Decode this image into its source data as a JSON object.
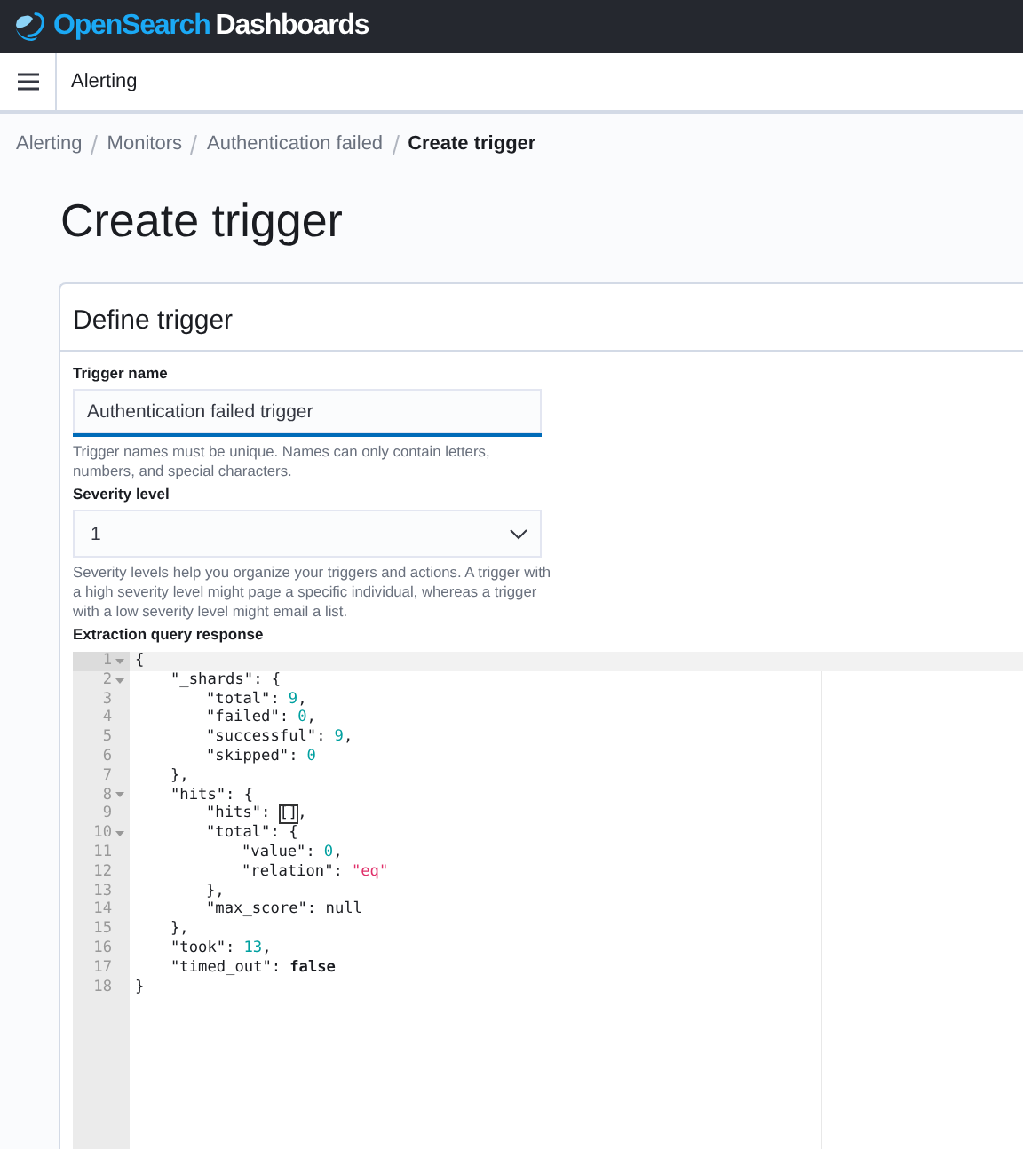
{
  "logo": {
    "brand": "OpenSearch",
    "product": "Dashboards"
  },
  "header": {
    "app_title": "Alerting"
  },
  "breadcrumbs": [
    {
      "label": "Alerting",
      "current": false
    },
    {
      "label": "Monitors",
      "current": false
    },
    {
      "label": "Authentication failed",
      "current": false
    },
    {
      "label": "Create trigger",
      "current": true
    }
  ],
  "page_title": "Create trigger",
  "panel": {
    "title": "Define trigger",
    "trigger_name": {
      "label": "Trigger name",
      "value": "Authentication failed trigger",
      "help": "Trigger names must be unique. Names can only contain letters, numbers, and special characters."
    },
    "severity": {
      "label": "Severity level",
      "value": "1",
      "help": "Severity levels help you organize your triggers and actions. A trigger with a high severity level might page a specific individual, whereas a trigger with a low severity level might email a list."
    },
    "response": {
      "label": "Extraction query response",
      "lines": [
        {
          "number": "1",
          "foldable": true,
          "active": true,
          "tokens": [
            {
              "kind": "punct",
              "text": "{"
            }
          ],
          "children": [
            {
              "number": "2",
              "foldable": true,
              "active": false,
              "tokens": [
                {
                  "kind": "key",
                  "text": "\"_shards\""
                },
                {
                  "kind": "punct",
                  "text": ": {"
                }
              ],
              "children": [
                {
                  "number": "3",
                  "foldable": false,
                  "active": false,
                  "tokens": [
                    {
                      "kind": "key",
                      "text": "\"total\""
                    },
                    {
                      "kind": "punct",
                      "text": ":"
                    },
                    {
                      "kind": "number",
                      "text": "9"
                    },
                    {
                      "kind": "punct",
                      "text": ","
                    }
                  ]
                },
                {
                  "number": "4",
                  "foldable": false,
                  "active": false,
                  "tokens": [
                    {
                      "kind": "key",
                      "text": "\"failed\""
                    },
                    {
                      "kind": "punct",
                      "text": ":"
                    },
                    {
                      "kind": "number",
                      "text": "0"
                    },
                    {
                      "kind": "punct",
                      "text": ","
                    }
                  ]
                },
                {
                  "number": "5",
                  "foldable": false,
                  "active": false,
                  "tokens": [
                    {
                      "kind": "key",
                      "text": "\"successful\""
                    },
                    {
                      "kind": "punct",
                      "text": ":"
                    },
                    {
                      "kind": "number",
                      "text": "9"
                    },
                    {
                      "kind": "punct",
                      "text": ","
                    }
                  ]
                },
                {
                  "number": "6",
                  "foldable": false,
                  "active": false,
                  "tokens": [
                    {
                      "kind": "key",
                      "text": "\"skipped\""
                    },
                    {
                      "kind": "punct",
                      "text": ":"
                    },
                    {
                      "kind": "number",
                      "text": "0"
                    }
                  ]
                }
              ]
            },
            {
              "number": "7",
              "foldable": false,
              "active": false,
              "tokens": [
                {
                  "kind": "punct",
                  "text": "},"
                }
              ]
            },
            {
              "number": "8",
              "foldable": true,
              "active": false,
              "tokens": [
                {
                  "kind": "key",
                  "text": "\"hits\""
                },
                {
                  "kind": "punct",
                  "text": ": {"
                }
              ],
              "children": [
                {
                  "number": "9",
                  "foldable": false,
                  "active": false,
                  "tokens": [
                    {
                      "kind": "key",
                      "text": "\"hits\""
                    },
                    {
                      "kind": "punct",
                      "text": ":"
                    },
                    {
                      "kind": "bracket",
                      "text": "[]"
                    },
                    {
                      "kind": "punct",
                      "text": ","
                    }
                  ]
                },
                {
                  "number": "10",
                  "foldable": true,
                  "active": false,
                  "tokens": [
                    {
                      "kind": "key",
                      "text": "\"total\""
                    },
                    {
                      "kind": "punct",
                      "text": ": {"
                    }
                  ],
                  "children": [
                    {
                      "number": "11",
                      "foldable": false,
                      "active": false,
                      "tokens": [
                        {
                          "kind": "key",
                          "text": "\"value\""
                        },
                        {
                          "kind": "punct",
                          "text": ":"
                        },
                        {
                          "kind": "number",
                          "text": "0"
                        },
                        {
                          "kind": "punct",
                          "text": ","
                        }
                      ]
                    },
                    {
                      "number": "12",
                      "foldable": false,
                      "active": false,
                      "tokens": [
                        {
                          "kind": "key",
                          "text": "\"relation\""
                        },
                        {
                          "kind": "punct",
                          "text": ":"
                        },
                        {
                          "kind": "string",
                          "text": "\"eq\""
                        }
                      ]
                    }
                  ]
                },
                {
                  "number": "13",
                  "foldable": false,
                  "active": false,
                  "tokens": [
                    {
                      "kind": "punct",
                      "text": "},"
                    }
                  ]
                },
                {
                  "number": "14",
                  "foldable": false,
                  "active": false,
                  "tokens": [
                    {
                      "kind": "key",
                      "text": "\"max_score\""
                    },
                    {
                      "kind": "punct",
                      "text": ": null"
                    }
                  ]
                }
              ]
            },
            {
              "number": "15",
              "foldable": false,
              "active": false,
              "tokens": [
                {
                  "kind": "punct",
                  "text": "},"
                }
              ]
            },
            {
              "number": "16",
              "foldable": false,
              "active": false,
              "tokens": [
                {
                  "kind": "key",
                  "text": "\"took\""
                },
                {
                  "kind": "punct",
                  "text": ":"
                },
                {
                  "kind": "number",
                  "text": "13"
                },
                {
                  "kind": "punct",
                  "text": ","
                }
              ]
            },
            {
              "number": "17",
              "foldable": false,
              "active": false,
              "tokens": [
                {
                  "kind": "key",
                  "text": "\"timed_out\""
                },
                {
                  "kind": "punct",
                  "text": ":"
                },
                {
                  "kind": "boolean",
                  "text": "false"
                }
              ]
            }
          ]
        },
        {
          "number": "18",
          "foldable": false,
          "active": false,
          "tokens": [
            {
              "kind": "punct",
              "text": "}"
            }
          ]
        }
      ]
    }
  }
}
